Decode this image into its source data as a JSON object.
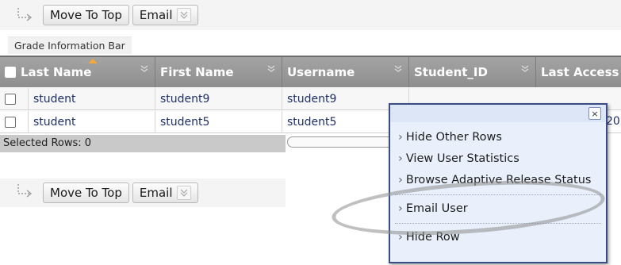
{
  "toolbar_top": {
    "move_to_top": "Move To Top",
    "email": "Email"
  },
  "grade_info_bar": "Grade Information Bar",
  "columns": [
    "Last Name",
    "First Name",
    "Username",
    "Student_ID",
    "Last Access"
  ],
  "rows": [
    {
      "last_name": "student",
      "first_name": "student9",
      "username": "student9"
    },
    {
      "last_name": "student",
      "first_name": "student5",
      "username": "student5"
    }
  ],
  "row2_peek": "20",
  "selected_rows": "Selected Rows: 0",
  "toolbar_bottom": {
    "move_to_top": "Move To Top",
    "email": "Email"
  },
  "popup_menu": {
    "items": [
      "Hide Other Rows",
      "View User Statistics",
      "Browse Adaptive Release Status",
      "Email User",
      "Hide Row"
    ],
    "close_label": "×"
  },
  "colors": {
    "header_gray": "#9a9a9a",
    "popup_bg": "#e9f0fb",
    "popup_border": "#3a4c84",
    "link_text": "#1f2f6a"
  }
}
